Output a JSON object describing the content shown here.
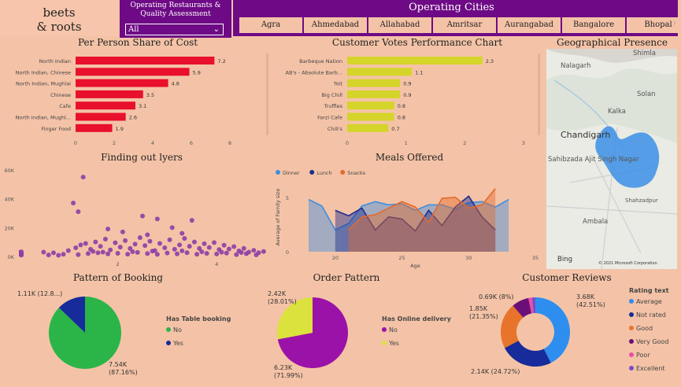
{
  "logo": {
    "line1": "beets",
    "line2": "& roots"
  },
  "filter": {
    "label": "Operating Restaurants & Quality Assessment",
    "value": "All"
  },
  "cities": {
    "title": "Operating Cities",
    "items": [
      "Agra",
      "Ahmedabad",
      "Allahabad",
      "Amritsar",
      "Aurangabad",
      "Bangalore",
      "Bhopal"
    ]
  },
  "colors": {
    "panel": "#f4c3a7",
    "header": "#6e0a85",
    "red": "#e8102a",
    "yellow": "#d4d42a",
    "purple": "#8e3ea6",
    "green": "#2bb548",
    "navy": "#172b9a",
    "magenta": "#9b12a8",
    "lime": "#dbe13d"
  },
  "chart_data": [
    {
      "id": "cost",
      "type": "bar",
      "title": "Per Person Share of Cost",
      "categories": [
        "North Indian",
        "North Indian, Chinese",
        "North Indian, Mughlai",
        "Chinese",
        "Cafe",
        "North Indian, Mughl...",
        "Finger Food"
      ],
      "values": [
        7.2,
        5.9,
        4.8,
        3.5,
        3.1,
        2.6,
        1.9
      ],
      "labels": [
        "7.2",
        "5.9",
        "4.8",
        "3.5",
        "3.1",
        "2.6",
        "1.9"
      ],
      "xticks": [
        "0",
        "2",
        "4",
        "6",
        "8"
      ],
      "xlim": [
        0,
        8
      ]
    },
    {
      "id": "votes",
      "type": "bar",
      "title": "Customer Votes Performance Chart",
      "categories": [
        "Barbeque Nation",
        "AB's - Absolute Barb...",
        "Toit",
        "Big Chill",
        "Truffles",
        "Farzi Cafe",
        "Chili's"
      ],
      "values": [
        2.3,
        1.1,
        0.9,
        0.9,
        0.8,
        0.8,
        0.7
      ],
      "labels": [
        "2.3",
        "1.1",
        "0.9",
        "0.9",
        "0.8",
        "0.8",
        "0.7"
      ],
      "xticks": [
        "0",
        "1",
        "2",
        "3"
      ],
      "xlim": [
        0,
        3
      ]
    },
    {
      "id": "outliers",
      "type": "scatter",
      "title": "Finding out lyers",
      "yticks": [
        "0K",
        "20K",
        "40K",
        "60K"
      ],
      "xticks": [
        "2",
        "4"
      ],
      "xlim": [
        0.0,
        5.0
      ],
      "ylim": [
        0,
        60000
      ],
      "points": [
        [
          0.05,
          1800
        ],
        [
          0.05,
          3200
        ],
        [
          0.05,
          900
        ],
        [
          1.3,
          55000
        ],
        [
          1.1,
          37000
        ],
        [
          1.2,
          31000
        ],
        [
          2.5,
          28000
        ],
        [
          3.5,
          25000
        ],
        [
          2.8,
          26000
        ],
        [
          1.8,
          19000
        ],
        [
          3.1,
          20000
        ],
        [
          2.1,
          17000
        ],
        [
          3.3,
          16000
        ],
        [
          2.6,
          15000
        ],
        [
          0.5,
          3000
        ],
        [
          0.7,
          2500
        ],
        [
          0.9,
          1500
        ],
        [
          1.0,
          4000
        ],
        [
          1.15,
          6000
        ],
        [
          1.25,
          8000
        ],
        [
          1.35,
          9000
        ],
        [
          1.45,
          5000
        ],
        [
          1.55,
          10000
        ],
        [
          1.65,
          7000
        ],
        [
          1.75,
          12000
        ],
        [
          1.85,
          4500
        ],
        [
          1.95,
          9500
        ],
        [
          2.05,
          6500
        ],
        [
          2.15,
          11000
        ],
        [
          2.25,
          5500
        ],
        [
          2.35,
          8500
        ],
        [
          2.45,
          13000
        ],
        [
          2.55,
          7500
        ],
        [
          2.65,
          10500
        ],
        [
          2.75,
          4000
        ],
        [
          2.85,
          9000
        ],
        [
          2.95,
          6000
        ],
        [
          3.05,
          11500
        ],
        [
          3.15,
          5000
        ],
        [
          3.25,
          8000
        ],
        [
          3.35,
          12500
        ],
        [
          3.45,
          7000
        ],
        [
          3.55,
          10000
        ],
        [
          3.65,
          5500
        ],
        [
          3.75,
          8800
        ],
        [
          3.85,
          6200
        ],
        [
          3.95,
          9600
        ],
        [
          4.05,
          4800
        ],
        [
          4.15,
          7800
        ],
        [
          4.25,
          5200
        ],
        [
          4.35,
          6800
        ],
        [
          4.45,
          3800
        ],
        [
          4.55,
          5600
        ],
        [
          4.65,
          3000
        ],
        [
          4.75,
          4200
        ],
        [
          4.85,
          2600
        ],
        [
          4.95,
          3400
        ],
        [
          1.4,
          2000
        ],
        [
          1.6,
          2500
        ],
        [
          1.8,
          1800
        ],
        [
          2.0,
          2200
        ],
        [
          2.2,
          1600
        ],
        [
          2.4,
          2800
        ],
        [
          2.6,
          2000
        ],
        [
          2.8,
          1400
        ],
        [
          3.0,
          2400
        ],
        [
          3.2,
          1800
        ],
        [
          3.4,
          2600
        ],
        [
          3.6,
          1500
        ],
        [
          3.8,
          2100
        ],
        [
          4.0,
          1700
        ],
        [
          4.2,
          2300
        ],
        [
          4.4,
          1200
        ],
        [
          4.6,
          1900
        ],
        [
          4.8,
          1100
        ],
        [
          1.2,
          1200
        ],
        [
          1.5,
          3500
        ],
        [
          1.7,
          3000
        ],
        [
          2.3,
          3300
        ],
        [
          2.7,
          3700
        ],
        [
          3.3,
          3900
        ],
        [
          3.7,
          3200
        ],
        [
          4.1,
          2900
        ],
        [
          4.5,
          2700
        ],
        [
          0.8,
          800
        ],
        [
          0.6,
          1000
        ]
      ]
    },
    {
      "id": "meals",
      "type": "area",
      "title": "Meals Offered",
      "ylabel": "Average of Family size",
      "xlabel": "Age",
      "xticks": [
        "20",
        "25",
        "30",
        "35"
      ],
      "yticks": [
        "0",
        "5"
      ],
      "xlim": [
        17,
        35
      ],
      "ylim": [
        0,
        6.5
      ],
      "series": [
        {
          "name": "Dinner",
          "color": "#3d8fe0",
          "x": [
            18,
            19,
            20,
            21,
            22,
            23,
            24,
            25,
            26,
            27,
            28,
            29,
            30,
            31,
            32,
            33
          ],
          "values": [
            4.8,
            4.2,
            2.0,
            2.6,
            4.2,
            4.6,
            4.3,
            4.4,
            3.8,
            4.3,
            4.3,
            3.9,
            4.5,
            4.6,
            4.1,
            4.8
          ]
        },
        {
          "name": "Lunch",
          "color": "#1f2d8c",
          "x": [
            20,
            21,
            22,
            23,
            24,
            25,
            26,
            27,
            28,
            29,
            30,
            31,
            32
          ],
          "values": [
            3.8,
            3.3,
            4.0,
            2.0,
            3.2,
            3.0,
            1.9,
            3.8,
            2.4,
            4.1,
            5.1,
            3.2,
            2.0
          ]
        },
        {
          "name": "Snacks",
          "color": "#e46a2c",
          "x": [
            21,
            22,
            23,
            24,
            25,
            26,
            27,
            28,
            29,
            30,
            31,
            32
          ],
          "values": [
            2.0,
            3.2,
            3.4,
            4.0,
            4.6,
            4.1,
            2.7,
            4.9,
            5.0,
            4.0,
            4.3,
            5.8
          ]
        }
      ]
    },
    {
      "id": "booking",
      "type": "pie",
      "title": "Pattern of Booking",
      "legend_title": "Has Table booking",
      "slices": [
        {
          "label": "No",
          "value": 7540,
          "text": "7.54K",
          "pct": "(87.16%)",
          "color": "#2bb548"
        },
        {
          "label": "Yes",
          "value": 1110,
          "text": "1.11K (12.8...)",
          "pct": "",
          "color": "#172b9a"
        }
      ]
    },
    {
      "id": "order",
      "type": "pie",
      "title": "Order Pattern",
      "legend_title": "Has Online delivery",
      "slices": [
        {
          "label": "No",
          "value": 6230,
          "text": "6.23K",
          "pct": "(71.99%)",
          "color": "#9b12a8"
        },
        {
          "label": "Yes",
          "value": 2420,
          "text": "2.42K",
          "pct": "(28.01%)",
          "color": "#dbe13d"
        }
      ]
    },
    {
      "id": "reviews",
      "type": "pie",
      "title": "Customer Reviews",
      "legend_title": "Rating text",
      "slices": [
        {
          "label": "Average",
          "value": 3680,
          "text": "3.68K",
          "pct": "(42.51%)",
          "color": "#2e8ef0"
        },
        {
          "label": "Not rated",
          "value": 2140,
          "text": "2.14K (24.72%)",
          "pct": "",
          "color": "#172b9a"
        },
        {
          "label": "Good",
          "value": 1850,
          "text": "1.85K",
          "pct": "(21.35%)",
          "color": "#e8742c"
        },
        {
          "label": "Very Good",
          "value": 690,
          "text": "0.69K (8%)",
          "pct": "",
          "color": "#6b0f78"
        },
        {
          "label": "Poor",
          "value": 150,
          "text": "",
          "pct": "",
          "color": "#e94fa7"
        },
        {
          "label": "Excellent",
          "value": 130,
          "text": "",
          "pct": "",
          "color": "#7a4cc7"
        }
      ]
    }
  ],
  "map": {
    "title": "Geographical Presence",
    "places": [
      "Shimla",
      "Nalagarh",
      "Solan",
      "Kalka",
      "Chandigarh",
      "Sahibzada Ajit Singh Nagar",
      "Shahzadpur",
      "Ambala"
    ],
    "bing": "Bing",
    "copyright": "© 2021 Microsoft Corporation"
  }
}
